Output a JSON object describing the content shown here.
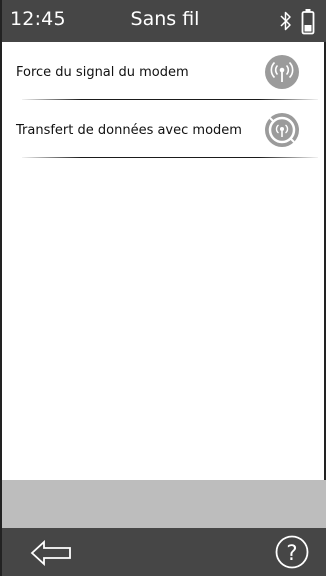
{
  "status_bar": {
    "time": "12:45",
    "title": "Sans fil",
    "icons": [
      "bluetooth-icon",
      "battery-icon"
    ]
  },
  "menu": {
    "items": [
      {
        "label": "Force du signal du modem",
        "icon": "antenna-signal-icon"
      },
      {
        "label": "Transfert de données avec modem",
        "icon": "data-transfer-icon"
      }
    ]
  },
  "nav": {
    "icons": [
      "back-arrow-icon",
      "help-icon"
    ],
    "help_glyph": "?"
  },
  "colors": {
    "bar_background": "#464646",
    "bottom_band": "#bdbdbd",
    "icon_gray": "#9b9b9b"
  }
}
